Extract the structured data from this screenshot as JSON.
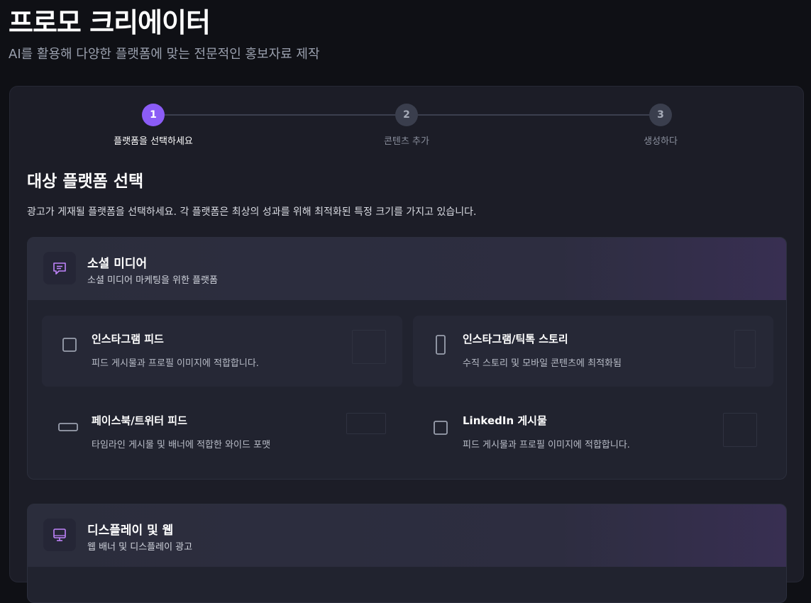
{
  "header": {
    "title": "프로모 크리에이터",
    "subtitle": "AI를 활용해 다양한 플랫폼에 맞는 전문적인 홍보자료 제작"
  },
  "stepper": {
    "steps": [
      {
        "number": "1",
        "label": "플랫폼을 선택하세요",
        "active": true
      },
      {
        "number": "2",
        "label": "콘텐츠 추가",
        "active": false
      },
      {
        "number": "3",
        "label": "생성하다",
        "active": false
      }
    ]
  },
  "section": {
    "title": "대상 플랫폼 선택",
    "description": "광고가 게재될 플랫폼을 선택하세요. 각 플랫폼은 최상의 성과를 위해 최적화된 특정 크기를 가지고 있습니다."
  },
  "categories": [
    {
      "title": "소셜 미디어",
      "subtitle": "소셜 미디어 마케팅을 위한 플랫폼",
      "icon": "message-icon",
      "options": [
        {
          "title": "인스타그램 피드",
          "description": "피드 게시물과 프로필 이미지에 적합합니다.",
          "icon": "square-icon"
        },
        {
          "title": "인스타그램/틱톡 스토리",
          "description": "수직 스토리 및 모바일 콘텐츠에 최적화됨",
          "icon": "portrait-icon"
        },
        {
          "title": "페이스북/트위터 피드",
          "description": "타임라인 게시물 및 배너에 적합한 와이드 포맷",
          "icon": "landscape-icon"
        },
        {
          "title": "LinkedIn 게시물",
          "description": "피드 게시물과 프로필 이미지에 적합합니다.",
          "icon": "square-icon"
        }
      ]
    },
    {
      "title": "디스플레이 및 웹",
      "subtitle": "웹 배너 및 디스플레이 광고",
      "icon": "monitor-icon"
    }
  ],
  "colors": {
    "accent": "#8b5cf6",
    "background": "#0f1015",
    "panel": "#1c1d27"
  }
}
